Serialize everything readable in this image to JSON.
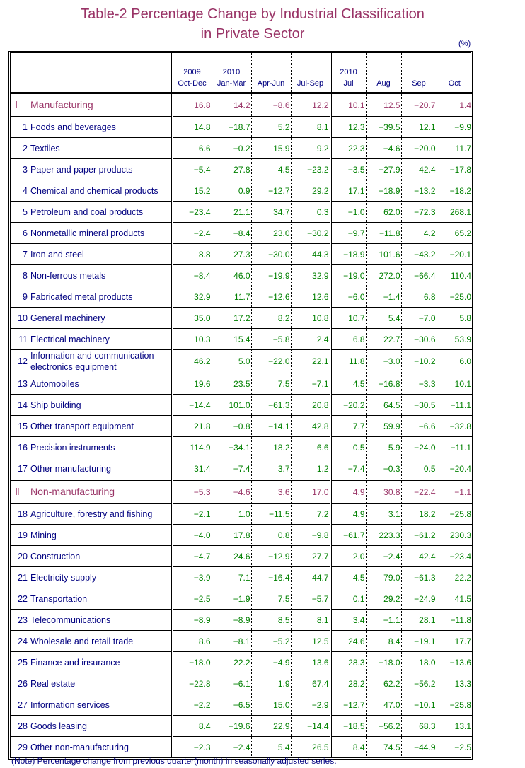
{
  "title": {
    "line1": "Table-2   Percentage Change by Industrial Classification",
    "line2": "in Private Sector"
  },
  "unit": "(%)",
  "columns": [
    {
      "year": "2009",
      "period": "Oct-Dec"
    },
    {
      "year": "2010",
      "period": "Jan-Mar"
    },
    {
      "year": "",
      "period": "Apr-Jun"
    },
    {
      "year": "",
      "period": "Jul-Sep"
    },
    {
      "year": "2010",
      "period": "Jul"
    },
    {
      "year": "",
      "period": "Aug"
    },
    {
      "year": "",
      "period": "Sep"
    },
    {
      "year": "",
      "period": "Oct"
    }
  ],
  "rows": [
    {
      "num": "Ⅰ",
      "label": "Manufacturing",
      "section": true,
      "values": [
        "16.8",
        "14.2",
        "−8.6",
        "12.2",
        "10.1",
        "12.5",
        "−20.7",
        "1.4"
      ]
    },
    {
      "num": "1",
      "label": "Foods and beverages",
      "values": [
        "14.8",
        "−18.7",
        "5.2",
        "8.1",
        "12.3",
        "−39.5",
        "12.1",
        "−9.9"
      ]
    },
    {
      "num": "2",
      "label": "Textiles",
      "values": [
        "6.6",
        "−0.2",
        "15.9",
        "9.2",
        "22.3",
        "−4.6",
        "−20.0",
        "11.7"
      ]
    },
    {
      "num": "3",
      "label": "Paper and paper products",
      "values": [
        "−5.4",
        "27.8",
        "4.5",
        "−23.2",
        "−3.5",
        "−27.9",
        "42.4",
        "−17.8"
      ]
    },
    {
      "num": "4",
      "label": "Chemical and chemical products",
      "values": [
        "15.2",
        "0.9",
        "−12.7",
        "29.2",
        "17.1",
        "−18.9",
        "−13.2",
        "−18.2"
      ]
    },
    {
      "num": "5",
      "label": "Petroleum and coal products",
      "values": [
        "−23.4",
        "21.1",
        "34.7",
        "0.3",
        "−1.0",
        "62.0",
        "−72.3",
        "268.1"
      ]
    },
    {
      "num": "6",
      "label": "Nonmetallic mineral products",
      "values": [
        "−2.4",
        "−8.4",
        "23.0",
        "−30.2",
        "−9.7",
        "−11.8",
        "4.2",
        "65.2"
      ]
    },
    {
      "num": "7",
      "label": "Iron and steel",
      "values": [
        "8.8",
        "27.3",
        "−30.0",
        "44.3",
        "−18.9",
        "101.6",
        "−43.2",
        "−20.1"
      ]
    },
    {
      "num": "8",
      "label": "Non-ferrous metals",
      "values": [
        "−8.4",
        "46.0",
        "−19.9",
        "32.9",
        "−19.0",
        "272.0",
        "−66.4",
        "110.4"
      ]
    },
    {
      "num": "9",
      "label": "Fabricated metal products",
      "values": [
        "32.9",
        "11.7",
        "−12.6",
        "12.6",
        "−6.0",
        "−1.4",
        "6.8",
        "−25.0"
      ]
    },
    {
      "num": "10",
      "label": "General machinery",
      "values": [
        "35.0",
        "17.2",
        "8.2",
        "10.8",
        "10.7",
        "5.4",
        "−7.0",
        "5.8"
      ]
    },
    {
      "num": "11",
      "label": "Electrical machinery",
      "values": [
        "10.3",
        "15.4",
        "−5.8",
        "2.4",
        "6.8",
        "22.7",
        "−30.6",
        "53.9"
      ]
    },
    {
      "num": "12",
      "label": "Information and communication electronics equipment",
      "two_line": true,
      "values": [
        "46.2",
        "5.0",
        "−22.0",
        "22.1",
        "11.8",
        "−3.0",
        "−10.2",
        "6.0"
      ]
    },
    {
      "num": "13",
      "label": "Automobiles",
      "values": [
        "19.6",
        "23.5",
        "7.5",
        "−7.1",
        "4.5",
        "−16.8",
        "−3.3",
        "10.1"
      ]
    },
    {
      "num": "14",
      "label": "Ship building",
      "values": [
        "−14.4",
        "101.0",
        "−61.3",
        "20.8",
        "−20.2",
        "64.5",
        "−30.5",
        "−11.1"
      ]
    },
    {
      "num": "15",
      "label": "Other transport equipment",
      "values": [
        "21.8",
        "−0.8",
        "−14.1",
        "42.8",
        "7.7",
        "59.9",
        "−6.6",
        "−32.8"
      ]
    },
    {
      "num": "16",
      "label": "Precision instruments",
      "values": [
        "114.9",
        "−34.1",
        "18.2",
        "6.6",
        "0.5",
        "5.9",
        "−24.0",
        "−11.1"
      ]
    },
    {
      "num": "17",
      "label": "Other manufacturing",
      "values": [
        "31.4",
        "−7.4",
        "3.7",
        "1.2",
        "−7.4",
        "−0.3",
        "0.5",
        "−20.4"
      ]
    },
    {
      "num": "Ⅱ",
      "label": "Non-manufacturing",
      "section": true,
      "values": [
        "−5.3",
        "−4.6",
        "3.6",
        "17.0",
        "4.9",
        "30.8",
        "−22.4",
        "−1.1"
      ]
    },
    {
      "num": "18",
      "label": "Agriculture, forestry and fishing",
      "values": [
        "−2.1",
        "1.0",
        "−11.5",
        "7.2",
        "4.9",
        "3.1",
        "18.2",
        "−25.8"
      ]
    },
    {
      "num": "19",
      "label": "Mining",
      "values": [
        "−4.0",
        "17.8",
        "0.8",
        "−9.8",
        "−61.7",
        "223.3",
        "−61.2",
        "230.3"
      ]
    },
    {
      "num": "20",
      "label": "Construction",
      "values": [
        "−4.7",
        "24.6",
        "−12.9",
        "27.7",
        "2.0",
        "−2.4",
        "42.4",
        "−23.4"
      ]
    },
    {
      "num": "21",
      "label": "Electricity supply",
      "values": [
        "−3.9",
        "7.1",
        "−16.4",
        "44.7",
        "4.5",
        "79.0",
        "−61.3",
        "22.2"
      ]
    },
    {
      "num": "22",
      "label": "Transportation",
      "values": [
        "−2.5",
        "−1.9",
        "7.5",
        "−5.7",
        "0.1",
        "29.2",
        "−24.9",
        "41.5"
      ]
    },
    {
      "num": "23",
      "label": "Telecommunications",
      "values": [
        "−8.9",
        "−8.9",
        "8.5",
        "8.1",
        "3.4",
        "−1.1",
        "28.1",
        "−11.8"
      ]
    },
    {
      "num": "24",
      "label": "Wholesale and retail trade",
      "values": [
        "8.6",
        "−8.1",
        "−5.2",
        "12.5",
        "24.6",
        "8.4",
        "−19.1",
        "17.7"
      ]
    },
    {
      "num": "25",
      "label": "Finance and insurance",
      "values": [
        "−18.0",
        "22.2",
        "−4.9",
        "13.6",
        "28.3",
        "−18.0",
        "18.0",
        "−13.6"
      ]
    },
    {
      "num": "26",
      "label": "Real estate",
      "values": [
        "−22.8",
        "−6.1",
        "1.9",
        "67.4",
        "28.2",
        "62.2",
        "−56.2",
        "13.3"
      ]
    },
    {
      "num": "27",
      "label": "Information services",
      "values": [
        "−2.2",
        "−6.5",
        "15.0",
        "−2.9",
        "−12.7",
        "47.0",
        "−10.1",
        "−25.8"
      ]
    },
    {
      "num": "28",
      "label": "Goods leasing",
      "values": [
        "8.4",
        "−19.6",
        "22.9",
        "−14.4",
        "−18.5",
        "−56.2",
        "68.3",
        "13.1"
      ]
    },
    {
      "num": "29",
      "label": "Other non-manufacturing",
      "values": [
        "−2.3",
        "−2.4",
        "5.4",
        "26.5",
        "8.4",
        "74.5",
        "−44.9",
        "−2.5"
      ]
    }
  ],
  "note": "(Note) Percentage change from previous quarter(month) in seasonally adjusted series.",
  "colors": {
    "title": "#993366",
    "section_text": "#993366",
    "label_text": "#000080",
    "value_text": "#008000"
  }
}
